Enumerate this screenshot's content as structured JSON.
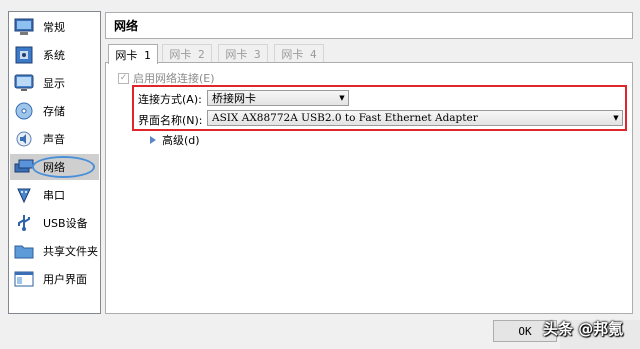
{
  "sidebar": {
    "items": [
      {
        "label": "常规",
        "icon": "general-icon"
      },
      {
        "label": "系统",
        "icon": "system-icon"
      },
      {
        "label": "显示",
        "icon": "display-icon"
      },
      {
        "label": "存储",
        "icon": "storage-icon"
      },
      {
        "label": "声音",
        "icon": "audio-icon"
      },
      {
        "label": "网络",
        "icon": "network-icon",
        "selected": true
      },
      {
        "label": "串口",
        "icon": "serial-port-icon"
      },
      {
        "label": "USB设备",
        "icon": "usb-icon"
      },
      {
        "label": "共享文件夹",
        "icon": "shared-folder-icon"
      },
      {
        "label": "用户界面",
        "icon": "user-interface-icon"
      }
    ]
  },
  "header": {
    "title": "网络"
  },
  "tabs": [
    {
      "label": "网卡 1",
      "active": true
    },
    {
      "label": "网卡 2"
    },
    {
      "label": "网卡 3"
    },
    {
      "label": "网卡 4"
    }
  ],
  "panel": {
    "enable_label": "启用网络连接(E)",
    "enable_checked": true,
    "attach_label": "连接方式(A):",
    "attach_value": "桥接网卡",
    "name_label": "界面名称(N):",
    "name_value": "ASIX AX88772A USB2.0 to Fast Ethernet Adapter",
    "advanced_label": "高级(d)"
  },
  "footer": {
    "ok_label": "OK"
  },
  "watermark": {
    "text": "头条 @邦氪"
  },
  "colors": {
    "highlight_box": "#e0252b",
    "selection_ellipse": "#4a90d9",
    "selected_bg": "#cfcfcf"
  }
}
